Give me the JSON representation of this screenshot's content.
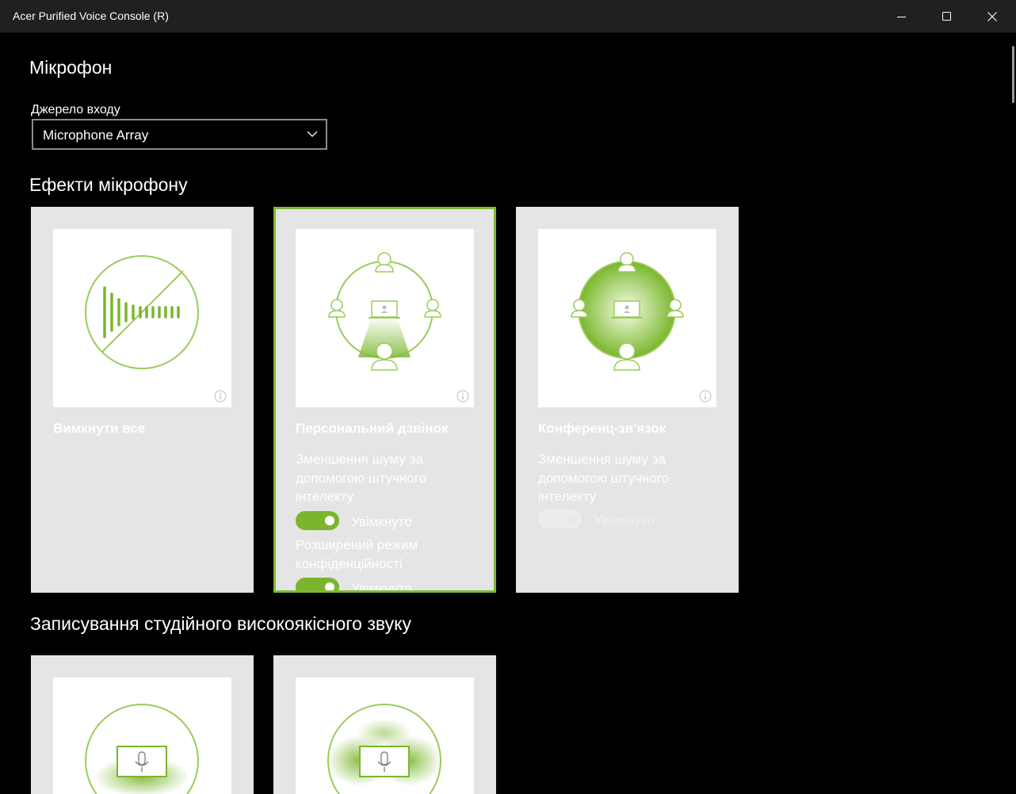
{
  "window": {
    "title": "Acer Purified Voice Console (R)",
    "minimize_icon": "minimize-icon",
    "maximize_icon": "maximize-icon",
    "close_icon": "close-icon"
  },
  "page": {
    "title": "Мікрофон"
  },
  "input_source": {
    "label": "Джерело входу",
    "selected": "Microphone Array"
  },
  "effects": {
    "heading": "Ефекти мікрофону",
    "cards": [
      {
        "name": "Вимкнути все",
        "icon": "mic-off-waveform-icon",
        "selected": false
      },
      {
        "name": "Персональний дзвінок",
        "icon": "personal-call-icon",
        "selected": true,
        "option1_label": "Зменшення шуму за допомогою штучного інтелекту",
        "option1_state": "Увімкнуто",
        "option2_label": "Розширений режим конфіденційності",
        "option2_state": "Увімкнуто"
      },
      {
        "name": "Конференц-зв'язок",
        "icon": "conference-call-icon",
        "selected": false,
        "option1_label": "Зменшення шуму за допомогою штучного інтелекту",
        "option1_state": "Увімкнуто"
      }
    ]
  },
  "studio": {
    "heading": "Записування студійного високоякісного звуку",
    "cards": [
      {
        "icon": "studio-laptop-mic-icon"
      },
      {
        "icon": "studio-laptop-mic-wide-icon"
      }
    ]
  },
  "colors": {
    "accent": "#7ab62d",
    "card_bg": "#e5e5e5",
    "titlebar": "#202020"
  }
}
